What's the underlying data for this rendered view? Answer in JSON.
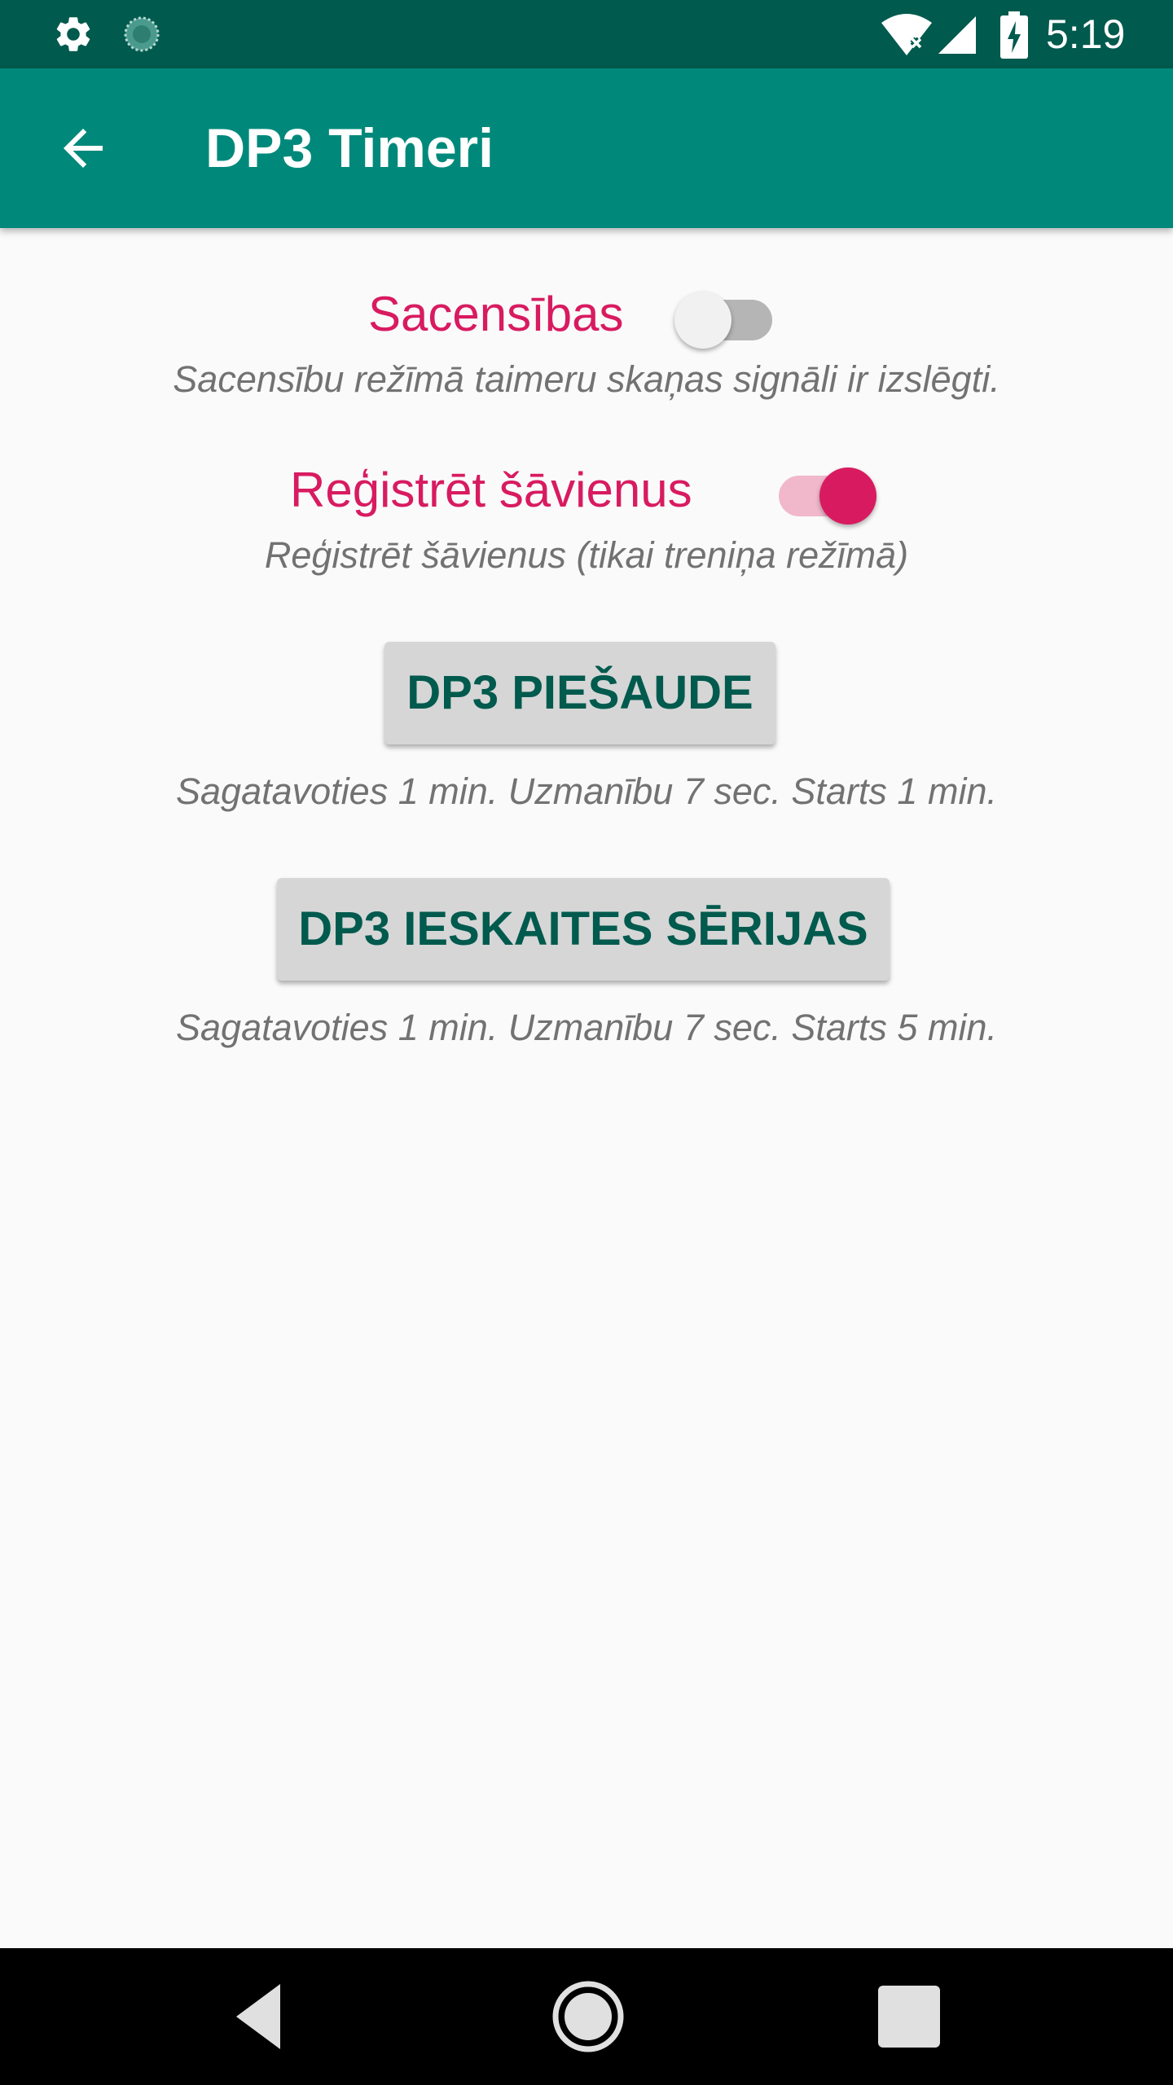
{
  "status_bar": {
    "time": "5:19",
    "icons": [
      "gear-icon",
      "sync-icon",
      "wifi-icon",
      "signal-icon",
      "battery-charging-icon"
    ],
    "background": "#005a4d"
  },
  "app_bar": {
    "title": "DP3 Timeri",
    "back_icon": "arrow-back-icon",
    "background": "#00897b"
  },
  "settings": {
    "competition": {
      "label": "Sacensības",
      "enabled": false,
      "hint": "Sacensību režīmā taimeru skaņas signāli ir izslēgti."
    },
    "register_shots": {
      "label": "Reģistrēt šāvienus",
      "enabled": true,
      "hint": "Reģistrēt šāvienus (tikai treniņa režīmā)"
    }
  },
  "buttons": {
    "practice": {
      "label": "DP3 PIEŠAUDE",
      "description": "Sagatavoties 1 min. Uzmanību 7 sec. Starts 1 min."
    },
    "series": {
      "label": "DP3 IESKAITES SĒRIJAS",
      "description": "Sagatavoties 1 min. Uzmanību 7 sec. Starts 5 min."
    }
  },
  "nav_bar": {
    "icons": [
      "nav-back-icon",
      "nav-home-icon",
      "nav-recents-icon"
    ]
  },
  "colors": {
    "accent": "#d81b60",
    "primary": "#00897b",
    "primary_dark": "#005a4d",
    "button_text": "#005a4d"
  }
}
